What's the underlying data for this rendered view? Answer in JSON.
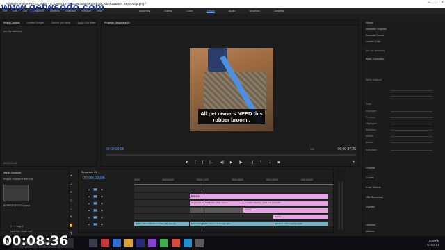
{
  "watermark": "www.getwsodo.com",
  "rec_time": "00:08:36",
  "window": {
    "title": "Adobe Premiere Pro CC 2018 - C:\\Users\\19795\\Downloads\\Facebook Ads\\RUBBER BROOM.prproj *"
  },
  "menu": [
    "File",
    "Edit",
    "Clip",
    "Sequence",
    "Markers",
    "Graphics",
    "Window",
    "Help"
  ],
  "workspaces": [
    {
      "label": "Assembly",
      "active": false
    },
    {
      "label": "Editing",
      "active": false
    },
    {
      "label": "Color",
      "active": false
    },
    {
      "label": "Effects",
      "active": true
    },
    {
      "label": "Audio",
      "active": false
    },
    {
      "label": "Graphics",
      "active": false
    },
    {
      "label": "Libraries",
      "active": false
    }
  ],
  "effect_controls": {
    "tabs": [
      "Effect Controls",
      "Lumetri Scopes",
      "Source: (no clips)",
      "Audio Clip Mixer"
    ],
    "no_selection": "(no clip selected)",
    "timecode": "00;00;02;06"
  },
  "program": {
    "tab": "Program: Sequence 01",
    "caption": "All pet owners NEED this rubber broom..",
    "timecode_current": "00;00;02;06",
    "timecode_total": "00;00;37;26",
    "fit": "1/2"
  },
  "right_panel": {
    "items": [
      "Effects",
      "Essential Graphics",
      "Essential Sound",
      "Lumetri Color",
      "(no clip selected)",
      "Basic Correction",
      "Creative",
      "Curves",
      "Color Wheels",
      "HSL Secondary",
      "Vignette",
      "Libraries",
      "Markers"
    ],
    "sub_items": [
      "White Balance",
      "Tone",
      "Exposure",
      "Contrast",
      "Highlights",
      "Shadows",
      "Whites",
      "Blacks",
      "Saturation"
    ]
  },
  "media_browser": {
    "tab": "Media Browser",
    "project": "Project: RUBBER BROOM",
    "file": "RUBBER BROOM.prproj",
    "rows": [
      "1 + 1 bags 2",
      "sand free beach mat"
    ]
  },
  "timeline": {
    "tab": "Sequence 01",
    "timecode": "00;00;02;06",
    "ruler": [
      "00;00",
      "00;00;15;00",
      "00;00;30;00",
      "00;00;45;00",
      "00;01;00;00",
      "00;01;15;00"
    ],
    "tracks": [
      {
        "name": "V4",
        "clips": []
      },
      {
        "name": "V3",
        "clips": [
          {
            "label": "Bold Font",
            "color": "pink",
            "start": 0.28,
            "end": 0.98
          }
        ]
      },
      {
        "name": "V2",
        "clips": [
          {
            "label": "All pet owners NEED this rubber broom..",
            "color": "pink",
            "start": 0.28,
            "end": 0.55
          },
          {
            "label": "It makes cleaning, quick and a breeze!",
            "color": "pink",
            "start": 0.55,
            "end": 0.98
          }
        ]
      },
      {
        "name": "V1",
        "clips": [
          {
            "label": "",
            "color": "gray",
            "start": 0.28,
            "end": 0.55
          },
          {
            "label": "Dearie",
            "color": "pink",
            "start": 0.55,
            "end": 0.98
          }
        ]
      },
      {
        "name": "A0",
        "clips": [
          {
            "label": "Dearie",
            "color": "pink",
            "start": 0.7,
            "end": 0.98
          }
        ]
      },
      {
        "name": "A1",
        "clips": [
          {
            "label": "Rubber Broom/Bathroom Floor (fft) mp4 [V]",
            "color": "teal",
            "start": 0.0,
            "end": 0.28
          },
          {
            "label": "Don Adok's Rubber Broom 4.mp4 [V].mp4",
            "color": "teal",
            "start": 0.28,
            "end": 0.7
          },
          {
            "label": "Scrubber rubber mp4 [V.mp4]",
            "color": "teal",
            "start": 0.7,
            "end": 0.98
          }
        ]
      }
    ]
  },
  "taskbar": {
    "search_placeholder": "Type here to search",
    "time": "8:59 PM",
    "date": "4/19/2019"
  }
}
